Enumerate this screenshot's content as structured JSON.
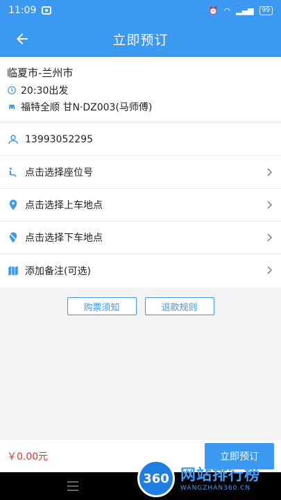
{
  "status_bar": {
    "time": "11:09",
    "battery": "99"
  },
  "header": {
    "title": "立即预订"
  },
  "trip": {
    "route": "临夏市-兰州市",
    "departure": "20:30出发",
    "vehicle": "福特全顺 甘N·DZ003(马师傅)"
  },
  "form": {
    "phone": "13993052295",
    "seat": "点击选择座位号",
    "pickup": "点击选择上车地点",
    "dropoff": "点击选择下车地点",
    "remark": "添加备注(可选)"
  },
  "links": {
    "notice": "购票须知",
    "refund": "退款规则"
  },
  "footer": {
    "price": "￥0.00元",
    "book_label": "立即预订"
  },
  "watermark": {
    "badge": "360",
    "title": "网站排行榜",
    "sub": "WANGZHAN360.CN"
  },
  "colors": {
    "primary": "#3b99f2",
    "price": "#e8352b"
  }
}
